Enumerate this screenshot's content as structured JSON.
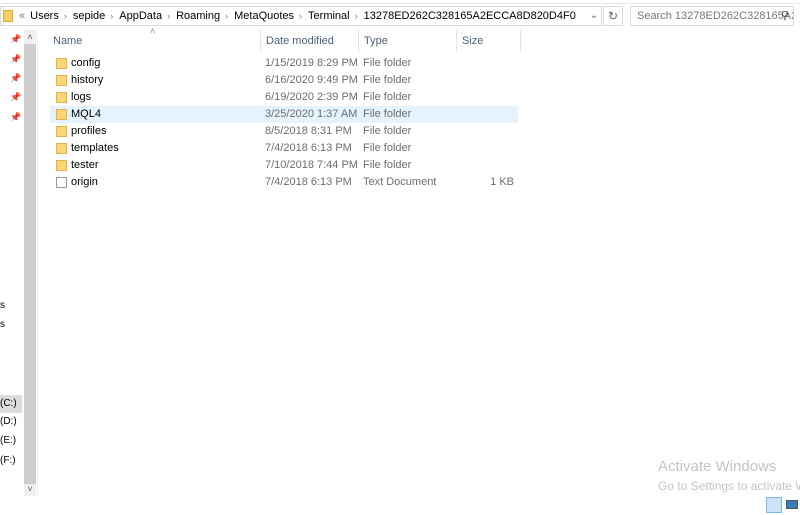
{
  "address_bar": {
    "overflow": "«",
    "crumbs": [
      "Users",
      "sepide",
      "AppData",
      "Roaming",
      "MetaQuotes",
      "Terminal",
      "13278ED262C328165A2ECCA8D820D4F0"
    ]
  },
  "search": {
    "placeholder": "Search 13278ED262C328165A2..."
  },
  "nav_pane": {
    "items": [
      "s",
      "s",
      "(C:)",
      "(D:)",
      "(E:)",
      "(F:)"
    ],
    "selected": "(C:)"
  },
  "columns": {
    "name": "Name",
    "date": "Date modified",
    "type": "Type",
    "size": "Size"
  },
  "files": [
    {
      "name": "config",
      "date": "1/15/2019 8:29 PM",
      "type": "File folder",
      "size": "",
      "icon": "folder-icon"
    },
    {
      "name": "history",
      "date": "6/16/2020 9:49 PM",
      "type": "File folder",
      "size": "",
      "icon": "folder-icon"
    },
    {
      "name": "logs",
      "date": "6/19/2020 2:39 PM",
      "type": "File folder",
      "size": "",
      "icon": "folder-icon"
    },
    {
      "name": "MQL4",
      "date": "3/25/2020 1:37 AM",
      "type": "File folder",
      "size": "",
      "icon": "folder-icon",
      "hovered": true
    },
    {
      "name": "profiles",
      "date": "8/5/2018 8:31 PM",
      "type": "File folder",
      "size": "",
      "icon": "folder-icon"
    },
    {
      "name": "templates",
      "date": "7/4/2018 6:13 PM",
      "type": "File folder",
      "size": "",
      "icon": "folder-icon"
    },
    {
      "name": "tester",
      "date": "7/10/2018 7:44 PM",
      "type": "File folder",
      "size": "",
      "icon": "folder-icon"
    },
    {
      "name": "origin",
      "date": "7/4/2018 6:13 PM",
      "type": "Text Document",
      "size": "1 KB",
      "icon": "text-document-icon"
    }
  ],
  "watermark": {
    "title": "Activate Windows",
    "subtitle": "Go to Settings to activate W"
  },
  "colors": {
    "hover_row": "#e5f3ff",
    "folder": "#f8d774",
    "header_text": "#4c607a"
  }
}
